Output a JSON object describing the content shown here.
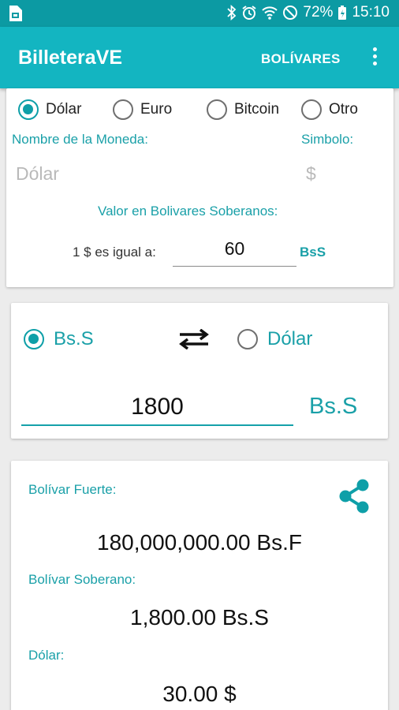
{
  "statusbar": {
    "battery": "72%",
    "time": "15:10"
  },
  "appbar": {
    "title": "BilleteraVE",
    "action": "BOLÍVARES"
  },
  "currency_options": [
    {
      "label": "Dólar",
      "checked": true
    },
    {
      "label": "Euro",
      "checked": false
    },
    {
      "label": "Bitcoin",
      "checked": false
    },
    {
      "label": "Otro",
      "checked": false
    }
  ],
  "currency_form": {
    "name_label": "Nombre de la Moneda:",
    "symbol_label": "Simbolo:",
    "name_value": "Dólar",
    "symbol_value": "$",
    "value_label": "Valor en Bolivares Soberanos:",
    "equals_label": "1 $ es igual a:",
    "rate": "60",
    "rate_unit": "BsS"
  },
  "converter": {
    "options": [
      {
        "label": "Bs.S",
        "checked": true
      },
      {
        "label": "Dólar",
        "checked": false
      }
    ],
    "amount": "1800",
    "unit": "Bs.S"
  },
  "results": {
    "fuerte_label": "Bolívar Fuerte:",
    "fuerte_value": "180,000,000.00 Bs.F",
    "soberano_label": "Bolívar Soberano:",
    "soberano_value": "1,800.00 Bs.S",
    "dolar_label": "Dólar:",
    "dolar_value": "30.00 $"
  },
  "colors": {
    "statusbar": "#0c9aa3",
    "appbar": "#13b5c1",
    "accent": "#0e9fa8"
  }
}
